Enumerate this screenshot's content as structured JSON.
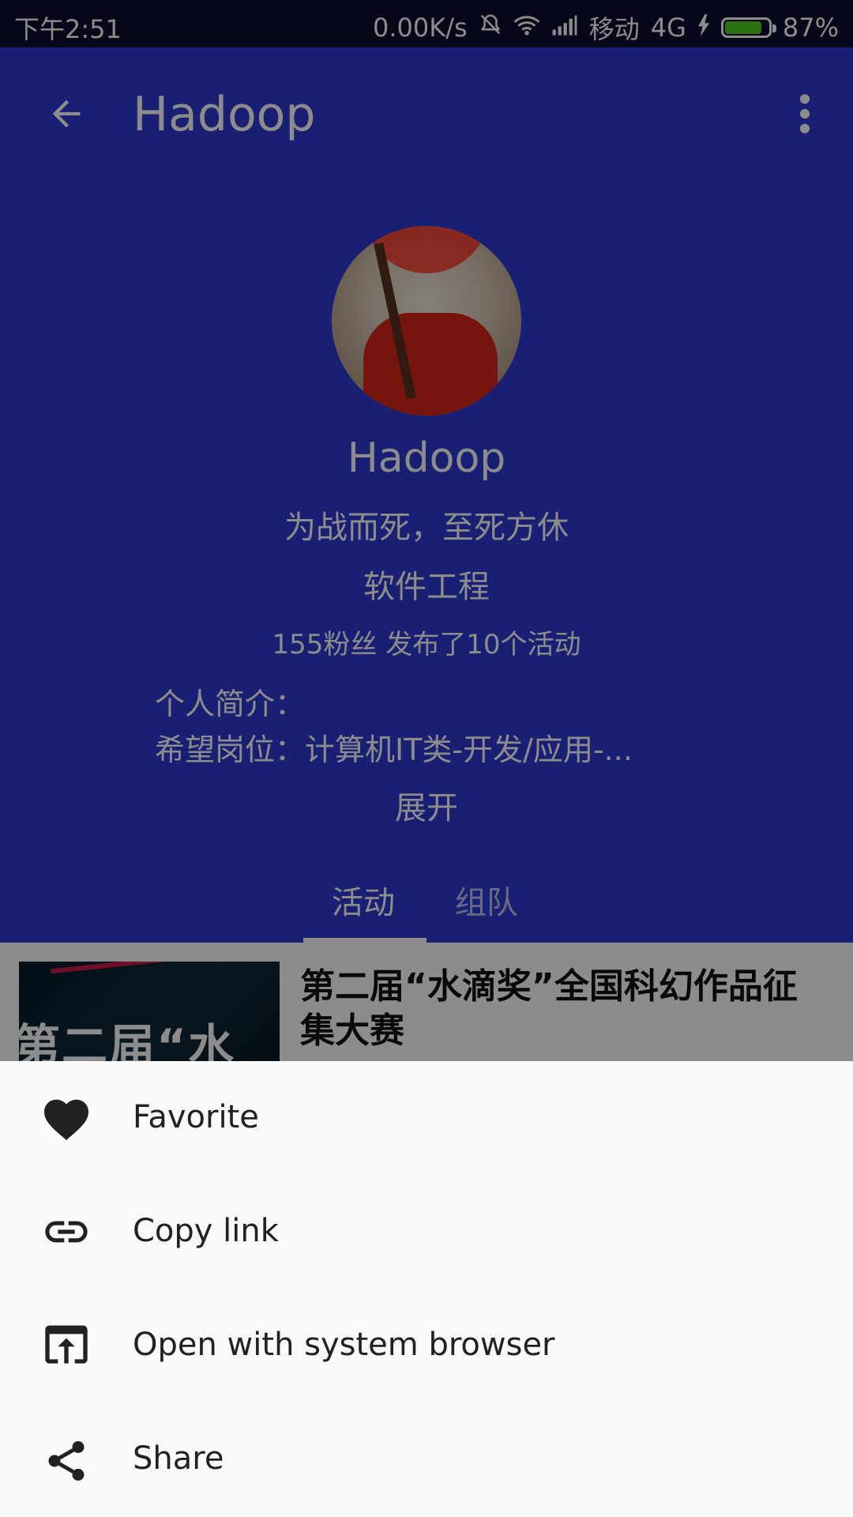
{
  "status_bar": {
    "time": "下午2:51",
    "net_speed": "0.00K/s",
    "carrier": "移动",
    "network": "4G",
    "battery": "87%",
    "battery_level": 0.87,
    "battery_color": "#4cd023"
  },
  "app_bar": {
    "title": "Hadoop",
    "back_icon": "arrow-left-icon",
    "more_icon": "more-vert-icon"
  },
  "profile": {
    "name": "Hadoop",
    "motto": "为战而死，至死方休",
    "major": "软件工程",
    "stats": "155粉丝 发布了10个活动",
    "intro_label": "个人简介：",
    "hope_label": "希望岗位：",
    "hope_value": "计算机IT类-开发/应用-...",
    "expand_label": "展开"
  },
  "tabs": [
    {
      "label": "活动",
      "active": true
    },
    {
      "label": "组队",
      "active": false
    }
  ],
  "activity_card": {
    "title": "第二届“水滴奖”全国科幻作品征集大赛",
    "thumbnail_text": "第二届“水滴奖"
  },
  "bottom_sheet": {
    "items": [
      {
        "label": "Favorite",
        "icon": "heart-icon"
      },
      {
        "label": "Copy link",
        "icon": "link-icon"
      },
      {
        "label": "Open with system browser",
        "icon": "open-in-browser-icon"
      },
      {
        "label": "Share",
        "icon": "share-icon"
      }
    ]
  },
  "colors": {
    "primary": "#2e3ad1",
    "status_bar": "#0b0f2f",
    "sheet_bg": "#fafafa"
  }
}
